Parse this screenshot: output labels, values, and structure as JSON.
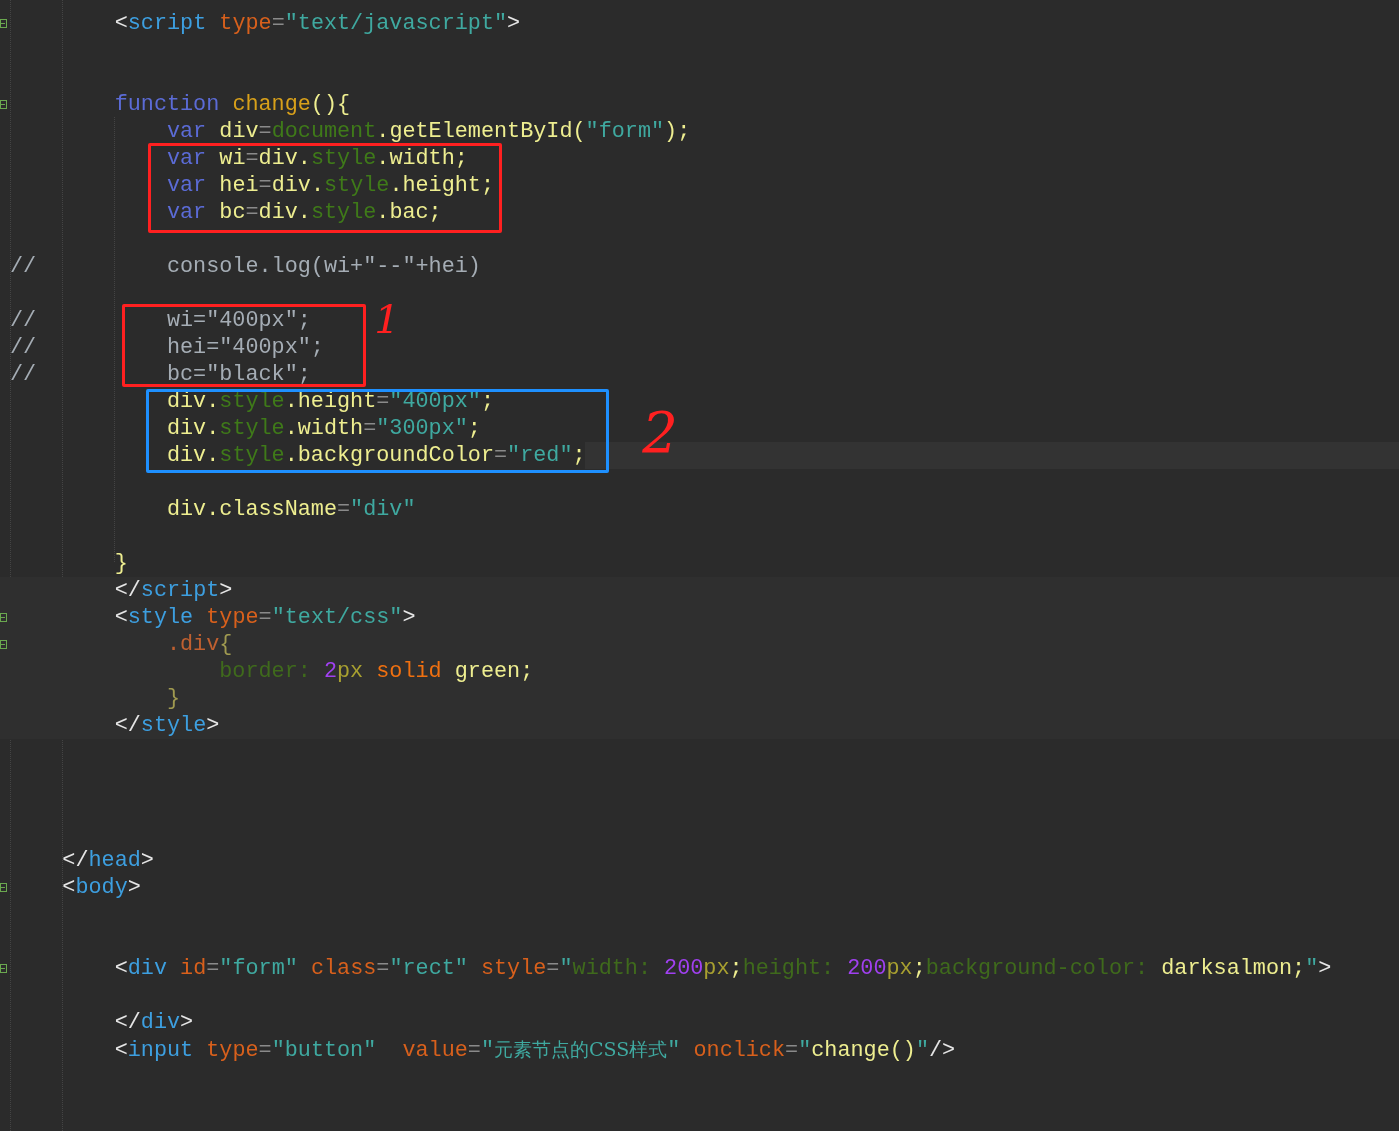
{
  "editor": {
    "lines": [
      {
        "kind": "plain"
      },
      {
        "kind": "plain",
        "fold": true,
        "tokens": [
          {
            "kind": "p",
            "text": "        <"
          },
          {
            "kind": "tag",
            "text": "script"
          },
          {
            "kind": "attr",
            "text": " type"
          },
          {
            "kind": "eq",
            "text": "="
          },
          {
            "kind": "str",
            "text": "\"text/javascript\""
          },
          {
            "kind": "p",
            "text": ">"
          }
        ]
      },
      {
        "kind": "plain"
      },
      {
        "kind": "plain"
      },
      {
        "kind": "plain",
        "fold": true,
        "tokens": [
          {
            "kind": "kw",
            "text": "        function"
          },
          {
            "kind": "fn",
            "text": " change"
          },
          {
            "kind": "id",
            "text": "(){"
          }
        ]
      },
      {
        "kind": "plain",
        "fold": false,
        "tokens": [
          {
            "kind": "kw",
            "text": "            var"
          },
          {
            "kind": "id",
            "text": " div"
          },
          {
            "kind": "eq",
            "text": "="
          },
          {
            "kind": "obj",
            "text": "document"
          },
          {
            "kind": "id",
            "text": ".getElementById("
          },
          {
            "kind": "str",
            "text": "\"form\""
          },
          {
            "kind": "id",
            "text": ");"
          }
        ]
      },
      {
        "kind": "plain",
        "fold": false,
        "tokens": [
          {
            "kind": "kw",
            "text": "            var"
          },
          {
            "kind": "id",
            "text": " wi"
          },
          {
            "kind": "eq",
            "text": "="
          },
          {
            "kind": "id",
            "text": "div."
          },
          {
            "kind": "obj",
            "text": "style"
          },
          {
            "kind": "id",
            "text": ".width;"
          }
        ]
      },
      {
        "kind": "plain",
        "fold": false,
        "tokens": [
          {
            "kind": "kw",
            "text": "            var"
          },
          {
            "kind": "id",
            "text": " hei"
          },
          {
            "kind": "eq",
            "text": "="
          },
          {
            "kind": "id",
            "text": "div."
          },
          {
            "kind": "obj",
            "text": "style"
          },
          {
            "kind": "id",
            "text": ".height;"
          }
        ]
      },
      {
        "kind": "plain",
        "fold": false,
        "tokens": [
          {
            "kind": "kw",
            "text": "            var"
          },
          {
            "kind": "id",
            "text": " bc"
          },
          {
            "kind": "eq",
            "text": "="
          },
          {
            "kind": "id",
            "text": "div."
          },
          {
            "kind": "obj",
            "text": "style"
          },
          {
            "kind": "id",
            "text": ".bac;"
          }
        ]
      },
      {
        "kind": "plain"
      },
      {
        "kind": "plain",
        "fold": false,
        "tokens": [
          {
            "kind": "cm",
            "text": "//          console.log(wi+\"--\"+hei)"
          }
        ]
      },
      {
        "kind": "plain"
      },
      {
        "kind": "plain",
        "fold": false,
        "tokens": [
          {
            "kind": "cm",
            "text": "//          wi=\"400px\";"
          }
        ]
      },
      {
        "kind": "plain",
        "fold": false,
        "tokens": [
          {
            "kind": "cm",
            "text": "//          hei=\"400px\";"
          }
        ]
      },
      {
        "kind": "plain",
        "fold": false,
        "tokens": [
          {
            "kind": "cm",
            "text": "//          bc=\"black\";"
          }
        ]
      },
      {
        "kind": "plain",
        "fold": false,
        "tokens": [
          {
            "kind": "id",
            "text": "            div."
          },
          {
            "kind": "obj",
            "text": "style"
          },
          {
            "kind": "id",
            "text": ".height"
          },
          {
            "kind": "eq",
            "text": "="
          },
          {
            "kind": "str",
            "text": "\"400px\""
          },
          {
            "kind": "id",
            "text": ";"
          }
        ]
      },
      {
        "kind": "plain",
        "fold": false,
        "tokens": [
          {
            "kind": "id",
            "text": "            div."
          },
          {
            "kind": "obj",
            "text": "style"
          },
          {
            "kind": "id",
            "text": ".width"
          },
          {
            "kind": "eq",
            "text": "="
          },
          {
            "kind": "str",
            "text": "\"300px\""
          },
          {
            "kind": "id",
            "text": ";"
          }
        ]
      },
      {
        "kind": "current",
        "fold": false,
        "tokens": [
          {
            "kind": "id",
            "text": "            div."
          },
          {
            "kind": "obj",
            "text": "style"
          },
          {
            "kind": "id",
            "text": ".backgroundColor"
          },
          {
            "kind": "eq",
            "text": "="
          },
          {
            "kind": "str",
            "text": "\"red\""
          },
          {
            "kind": "id",
            "text": ";"
          }
        ]
      },
      {
        "kind": "plain"
      },
      {
        "kind": "plain",
        "fold": false,
        "tokens": [
          {
            "kind": "id",
            "text": "            div.className"
          },
          {
            "kind": "eq",
            "text": "="
          },
          {
            "kind": "str",
            "text": "\"div\""
          }
        ]
      },
      {
        "kind": "plain"
      },
      {
        "kind": "plain",
        "fold": false,
        "tokens": [
          {
            "kind": "id",
            "text": "        }"
          }
        ]
      },
      {
        "kind": "block",
        "fold": false,
        "tokens": [
          {
            "kind": "p",
            "text": "        </"
          },
          {
            "kind": "tag",
            "text": "script"
          },
          {
            "kind": "p",
            "text": ">"
          }
        ]
      },
      {
        "kind": "block",
        "fold": true,
        "tokens": [
          {
            "kind": "p",
            "text": "        <"
          },
          {
            "kind": "tag",
            "text": "style"
          },
          {
            "kind": "attr",
            "text": " type"
          },
          {
            "kind": "eq",
            "text": "="
          },
          {
            "kind": "str",
            "text": "\"text/css\""
          },
          {
            "kind": "p",
            "text": ">"
          }
        ]
      },
      {
        "kind": "block",
        "fold": true,
        "tokens": [
          {
            "kind": "sel",
            "text": "            .div"
          },
          {
            "kind": "brace",
            "text": "{"
          }
        ]
      },
      {
        "kind": "block",
        "fold": false,
        "tokens": [
          {
            "kind": "prop",
            "text": "                border:"
          },
          {
            "kind": "num",
            "text": " 2"
          },
          {
            "kind": "unit",
            "text": "px"
          },
          {
            "kind": "val",
            "text": " solid"
          },
          {
            "kind": "id",
            "text": " green;"
          }
        ]
      },
      {
        "kind": "block",
        "fold": false,
        "tokens": [
          {
            "kind": "brace",
            "text": "            }"
          }
        ]
      },
      {
        "kind": "block",
        "fold": false,
        "tokens": [
          {
            "kind": "p",
            "text": "        </"
          },
          {
            "kind": "tag",
            "text": "style"
          },
          {
            "kind": "p",
            "text": ">"
          }
        ]
      },
      {
        "kind": "plain"
      },
      {
        "kind": "plain"
      },
      {
        "kind": "plain"
      },
      {
        "kind": "plain"
      },
      {
        "kind": "plain",
        "fold": false,
        "tokens": [
          {
            "kind": "p",
            "text": "    </"
          },
          {
            "kind": "tag",
            "text": "head"
          },
          {
            "kind": "p",
            "text": ">"
          }
        ]
      },
      {
        "kind": "plain",
        "fold": true,
        "tokens": [
          {
            "kind": "p",
            "text": "    <"
          },
          {
            "kind": "tag",
            "text": "body"
          },
          {
            "kind": "p",
            "text": ">"
          }
        ]
      },
      {
        "kind": "plain"
      },
      {
        "kind": "plain"
      },
      {
        "kind": "plain",
        "fold": true,
        "tokens": [
          {
            "kind": "p",
            "text": "        <"
          },
          {
            "kind": "tag",
            "text": "div"
          },
          {
            "kind": "attr",
            "text": " id"
          },
          {
            "kind": "eq",
            "text": "="
          },
          {
            "kind": "str",
            "text": "\"form\""
          },
          {
            "kind": "attr",
            "text": " class"
          },
          {
            "kind": "eq",
            "text": "="
          },
          {
            "kind": "str",
            "text": "\"rect\""
          },
          {
            "kind": "attr",
            "text": " style"
          },
          {
            "kind": "eq",
            "text": "="
          },
          {
            "kind": "str",
            "text": "\""
          },
          {
            "kind": "prop",
            "text": "width:"
          },
          {
            "kind": "num",
            "text": " 200"
          },
          {
            "kind": "unit",
            "text": "px"
          },
          {
            "kind": "id",
            "text": ";"
          },
          {
            "kind": "prop",
            "text": "height:"
          },
          {
            "kind": "num",
            "text": " 200"
          },
          {
            "kind": "unit",
            "text": "px"
          },
          {
            "kind": "id",
            "text": ";"
          },
          {
            "kind": "prop",
            "text": "background-color:"
          },
          {
            "kind": "id",
            "text": " darksalmon;"
          },
          {
            "kind": "str",
            "text": "\""
          },
          {
            "kind": "p",
            "text": ">"
          }
        ]
      },
      {
        "kind": "plain"
      },
      {
        "kind": "plain",
        "fold": false,
        "tokens": [
          {
            "kind": "p",
            "text": "        </"
          },
          {
            "kind": "tag",
            "text": "div"
          },
          {
            "kind": "p",
            "text": ">"
          }
        ]
      },
      {
        "kind": "plain",
        "fold": false,
        "tokens": [
          {
            "kind": "p",
            "text": "        <"
          },
          {
            "kind": "tag",
            "text": "input"
          },
          {
            "kind": "attr",
            "text": " type"
          },
          {
            "kind": "eq",
            "text": "="
          },
          {
            "kind": "str",
            "text": "\"button\""
          },
          {
            "kind": "attr",
            "text": "  value"
          },
          {
            "kind": "eq",
            "text": "="
          },
          {
            "kind": "str",
            "text": "\""
          },
          {
            "kind": "cjk",
            "text": "元素节点的CSS样式"
          },
          {
            "kind": "str",
            "text": "\""
          },
          {
            "kind": "attr",
            "text": " onclick"
          },
          {
            "kind": "eq",
            "text": "="
          },
          {
            "kind": "str",
            "text": "\""
          },
          {
            "kind": "id",
            "text": "change()"
          },
          {
            "kind": "str",
            "text": "\""
          },
          {
            "kind": "p",
            "text": "/>"
          }
        ]
      },
      {
        "kind": "plain"
      },
      {
        "kind": "plain"
      },
      {
        "kind": "plain"
      }
    ]
  },
  "annotations": [
    {
      "kind": "box",
      "color": "#ff2020"
    },
    {
      "kind": "box",
      "color": "#ff2020"
    },
    {
      "kind": "box",
      "color": "#1e90ff"
    },
    {
      "kind": "note",
      "color": "#ff2020",
      "text": "1"
    },
    {
      "kind": "note",
      "color": "#ff2020",
      "text": "2"
    }
  ]
}
